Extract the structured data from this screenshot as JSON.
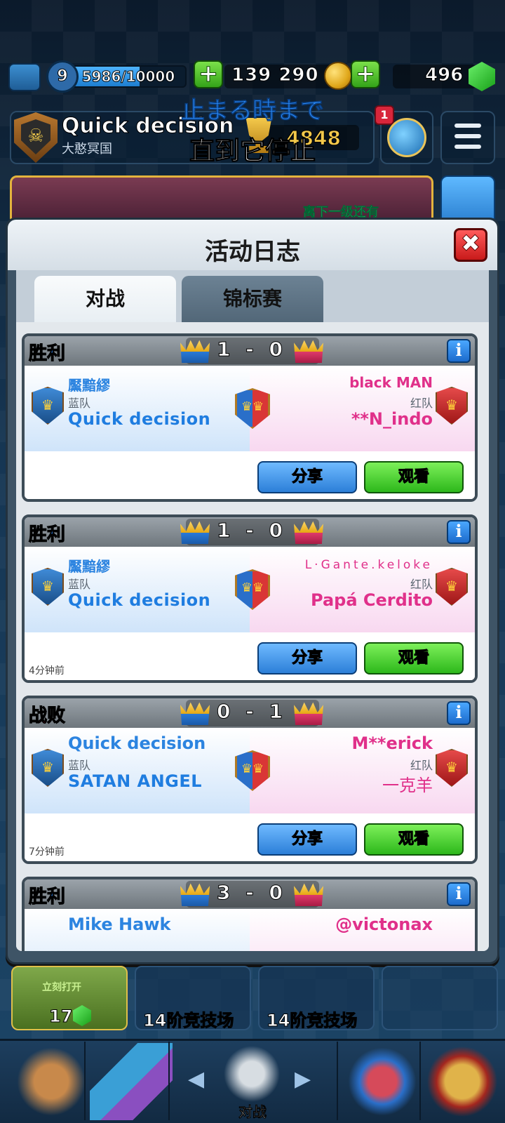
{
  "hud": {
    "level": "9",
    "xp_text": "5986/10000",
    "xp_fraction": 0.5986,
    "gold": "139 290",
    "gems": "496",
    "plus_symbol": "+"
  },
  "profile": {
    "player_name": "Quick decision",
    "clan_name": "大憨冥国",
    "trophies": "4848",
    "notification_count": "1"
  },
  "subtitles": {
    "line1": "止まる時まで",
    "line2": "直到它停止"
  },
  "banner": {
    "text": "离下一级还有"
  },
  "modal": {
    "title": "活动日志",
    "close_symbol": "✖",
    "tabs": [
      {
        "label": "对战",
        "active": true
      },
      {
        "label": "锦标赛",
        "active": false
      }
    ]
  },
  "battles": [
    {
      "result": "胜利",
      "outcome": "win",
      "score": "1 - 0",
      "left_clan": "黶黯繆",
      "left_team": "蓝队",
      "left_name": "Quick decision",
      "right_clan": "black MAN",
      "right_team": "红队",
      "right_name": "**N_indo",
      "time": "",
      "share_label": "分享",
      "watch_label": "观看"
    },
    {
      "result": "胜利",
      "outcome": "win",
      "score": "1 - 0",
      "left_clan": "黶黯繆",
      "left_team": "蓝队",
      "left_name": "Quick decision",
      "right_clan": "L·Gante.keloke",
      "right_team": "红队",
      "right_name": "Papá Cerdito",
      "time": "4分钟前",
      "share_label": "分享",
      "watch_label": "观看"
    },
    {
      "result": "战败",
      "outcome": "lose",
      "score": "0 - 1",
      "left_clan": "Quick decision",
      "left_team": "蓝队",
      "left_name": "SATAN ANGEL",
      "right_clan": "M**erick",
      "right_team": "红队",
      "right_name": "一克羊",
      "time": "7分钟前",
      "share_label": "分享",
      "watch_label": "观看"
    },
    {
      "result": "胜利",
      "outcome": "win",
      "score": "3 - 0",
      "left_clan": "Mike Hawk",
      "right_clan": "@victonax"
    }
  ],
  "chests": [
    {
      "label": "17",
      "small": "立刻打开",
      "ready": true
    },
    {
      "label": "14阶竞技场",
      "ready": false
    },
    {
      "label": "14阶竞技场",
      "ready": false
    }
  ],
  "nav": {
    "active_label": "对战"
  },
  "colors": {
    "win": "#2f8cff",
    "lose": "#ff2a55",
    "share_button": "#2c7fd8",
    "watch_button": "#2db81b",
    "close_button": "#c81a1a"
  }
}
